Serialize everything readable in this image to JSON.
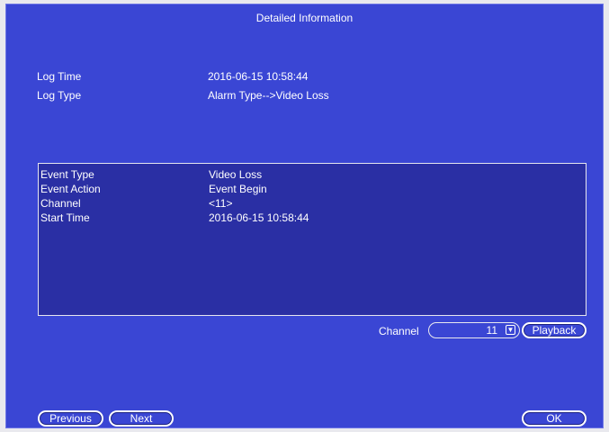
{
  "dialog": {
    "title": "Detailed Information"
  },
  "summary": {
    "log_time_label": "Log Time",
    "log_time_value": "2016-06-15 10:58:44",
    "log_type_label": "Log Type",
    "log_type_value": "Alarm Type-->Video Loss"
  },
  "details": [
    {
      "key": "Event Type",
      "value": "Video Loss"
    },
    {
      "key": "Event Action",
      "value": "Event Begin"
    },
    {
      "key": "Channel",
      "value": "<11>"
    },
    {
      "key": "Start Time",
      "value": "2016-06-15 10:58:44"
    }
  ],
  "channel": {
    "label": "Channel",
    "selected": "11"
  },
  "buttons": {
    "playback": "Playback",
    "previous": "Previous",
    "next": "Next",
    "ok": "OK"
  },
  "colors": {
    "background": "#3a46d4",
    "panel": "#2a2fa4",
    "text": "#ffffff"
  }
}
